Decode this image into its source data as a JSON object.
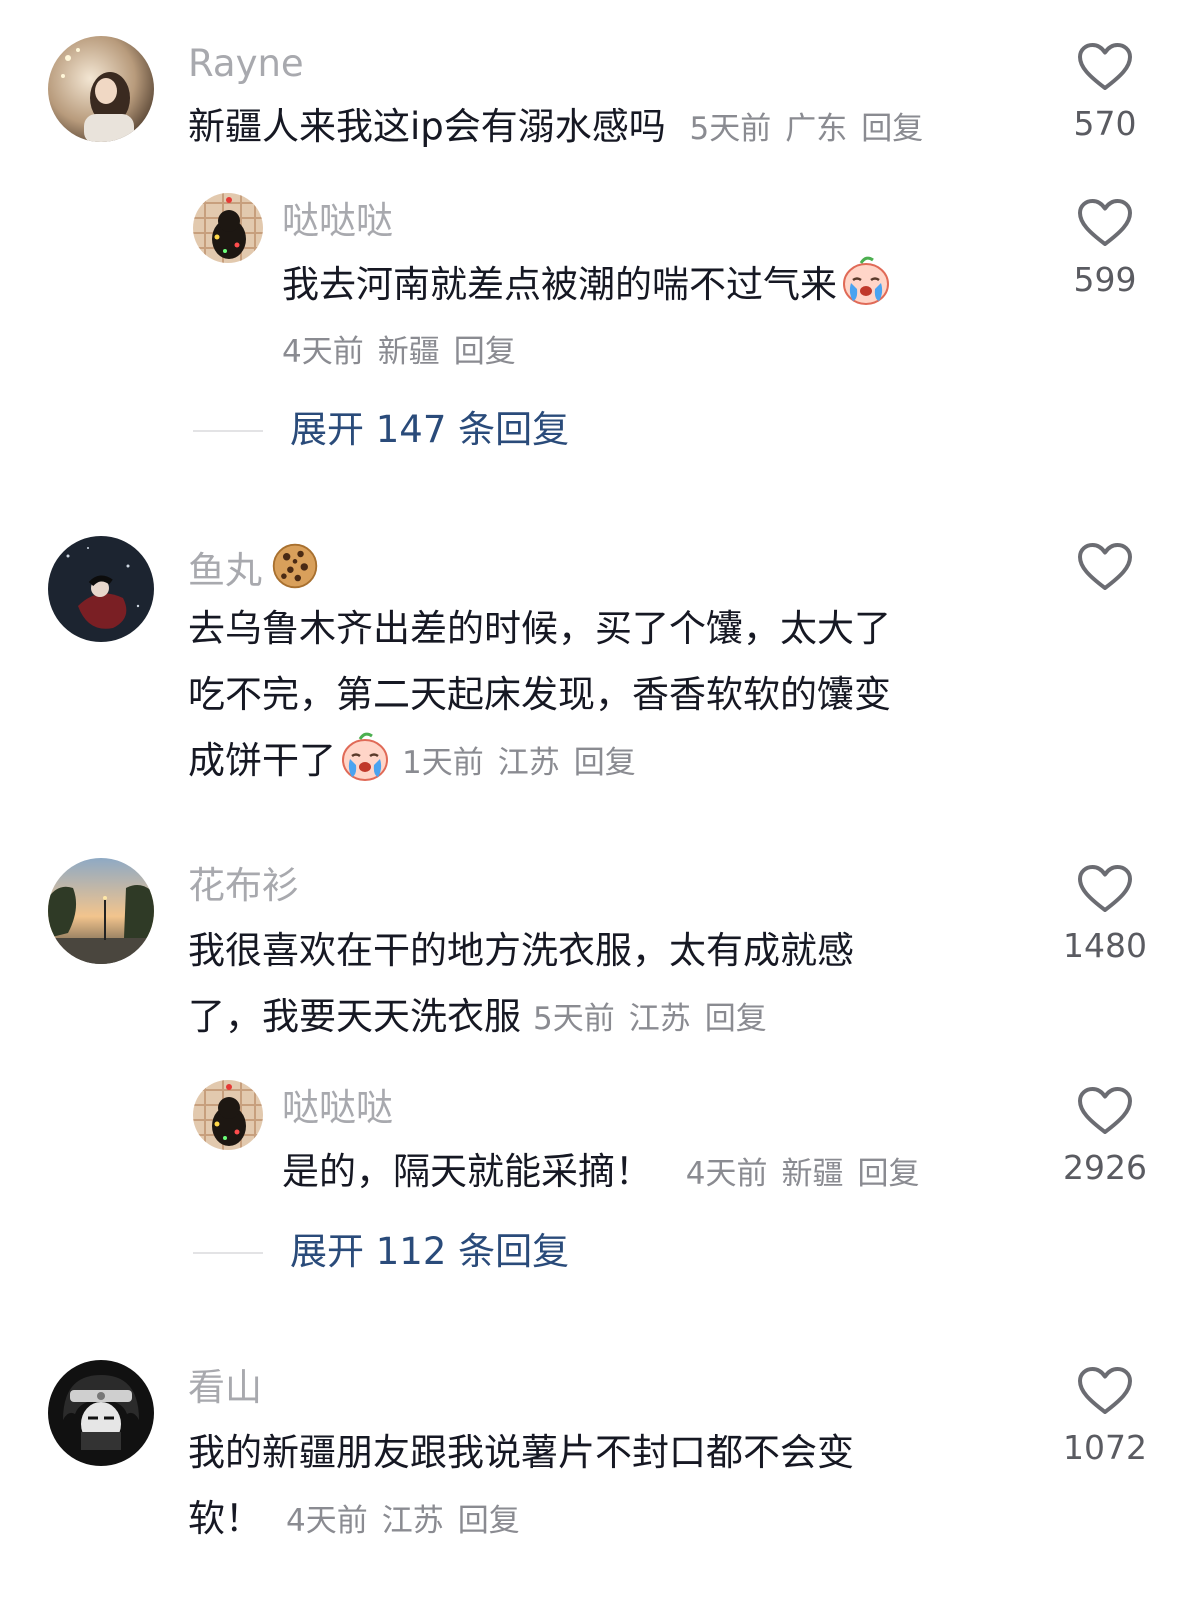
{
  "comments": [
    {
      "username": "Rayne",
      "text": "新疆人来我这ip会有溺水感吗",
      "time": "5天前",
      "location": "广东",
      "reply_label": "回复",
      "likes": "570",
      "replies": [
        {
          "username": "哒哒哒",
          "text": "我去河南就差点被潮的喘不过气来",
          "emoji": "crying-face-emoji",
          "time": "4天前",
          "location": "新疆",
          "reply_label": "回复",
          "likes": "599"
        }
      ],
      "expand_label": "展开 147 条回复"
    },
    {
      "username": "鱼丸",
      "username_emoji": "cookie-emoji",
      "text_lines": [
        "去乌鲁木齐出差的时候，买了个馕，太大了",
        "吃不完，第二天起床发现，香香软软的馕变",
        "成饼干了"
      ],
      "emoji": "crying-face-emoji",
      "time": "1天前",
      "location": "江苏",
      "reply_label": "回复",
      "likes": ""
    },
    {
      "username": "花布衫",
      "text_lines": [
        "我很喜欢在干的地方洗衣服，太有成就感",
        "了，我要天天洗衣服"
      ],
      "time": "5天前",
      "location": "江苏",
      "reply_label": "回复",
      "likes": "1480",
      "replies": [
        {
          "username": "哒哒哒",
          "text": "是的，隔天就能采摘！",
          "time": "4天前",
          "location": "新疆",
          "reply_label": "回复",
          "likes": "2926"
        }
      ],
      "expand_label": "展开 112 条回复"
    },
    {
      "username": "看山",
      "text_lines": [
        "我的新疆朋友跟我说薯片不封口都不会变",
        "软！"
      ],
      "time": "4天前",
      "location": "江苏",
      "reply_label": "回复",
      "likes": "1072"
    }
  ],
  "colors": {
    "username": "#a8a9ae",
    "text": "#161823",
    "meta": "#8a8b91",
    "expand_link": "#2a4b7a",
    "heart": "#6b6c72"
  },
  "icons": {
    "like": "heart-outline-icon"
  }
}
